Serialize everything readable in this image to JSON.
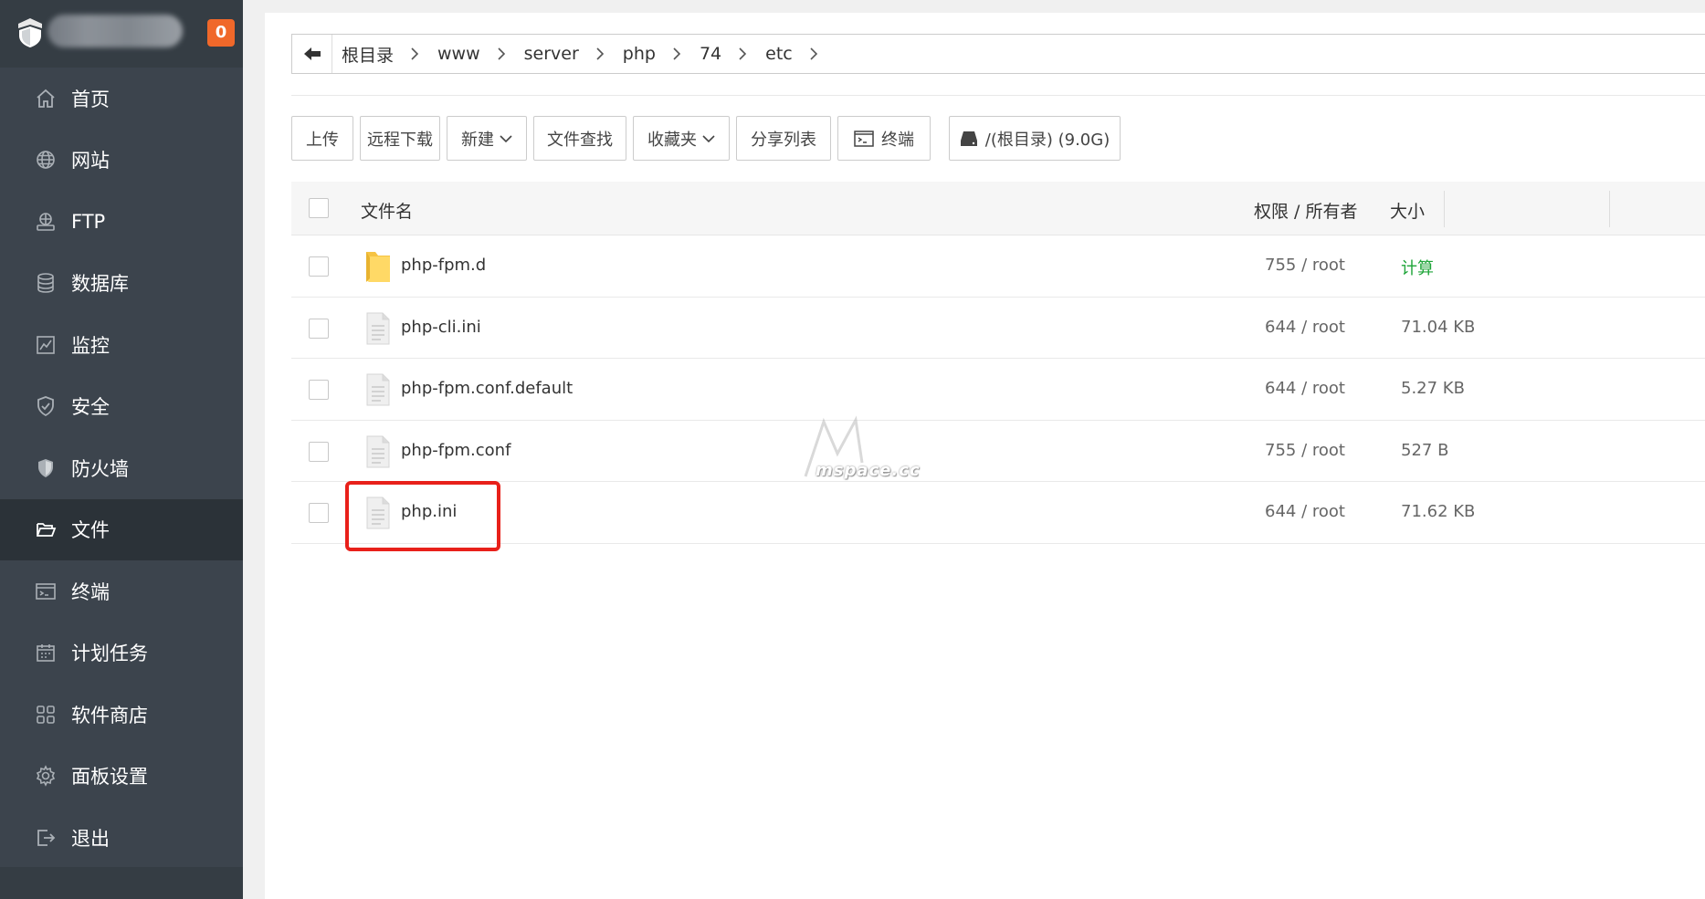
{
  "sidebar": {
    "badge": "0",
    "items": [
      {
        "label": "首页",
        "icon": "home-icon"
      },
      {
        "label": "网站",
        "icon": "globe-icon"
      },
      {
        "label": "FTP",
        "icon": "ftp-icon"
      },
      {
        "label": "数据库",
        "icon": "database-icon"
      },
      {
        "label": "监控",
        "icon": "monitor-icon"
      },
      {
        "label": "安全",
        "icon": "shield-check-icon"
      },
      {
        "label": "防火墙",
        "icon": "firewall-shield-icon"
      },
      {
        "label": "文件",
        "icon": "folder-open-icon",
        "active": true
      },
      {
        "label": "终端",
        "icon": "terminal-icon"
      },
      {
        "label": "计划任务",
        "icon": "calendar-icon"
      },
      {
        "label": "软件商店",
        "icon": "grid-apps-icon"
      },
      {
        "label": "面板设置",
        "icon": "gear-icon"
      },
      {
        "label": "退出",
        "icon": "logout-icon"
      }
    ]
  },
  "breadcrumb": [
    "根目录",
    "www",
    "server",
    "php",
    "74",
    "etc"
  ],
  "toolbar": {
    "upload": "上传",
    "remote_download": "远程下载",
    "new": "新建",
    "file_search": "文件查找",
    "favorites": "收藏夹",
    "share_list": "分享列表",
    "terminal": "终端",
    "disk": "/(根目录) (9.0G)"
  },
  "table": {
    "headers": {
      "name": "文件名",
      "perm": "权限 / 所有者",
      "size": "大小"
    },
    "rows": [
      {
        "name": "php-fpm.d",
        "type": "folder",
        "perm": "755 / root",
        "size": "计算"
      },
      {
        "name": "php-cli.ini",
        "type": "file",
        "perm": "644 / root",
        "size": "71.04 KB"
      },
      {
        "name": "php-fpm.conf.default",
        "type": "file",
        "perm": "644 / root",
        "size": "5.27 KB"
      },
      {
        "name": "php-fpm.conf",
        "type": "file",
        "perm": "755 / root",
        "size": "527 B"
      },
      {
        "name": "php.ini",
        "type": "file",
        "perm": "644 / root",
        "size": "71.62 KB"
      }
    ]
  },
  "watermark": "mspace.cc",
  "colors": {
    "sidebar": "#3c444d",
    "sidebar_active": "#2b3238",
    "badge": "#f0682a",
    "green": "#20a53a",
    "highlight": "#e8201a"
  }
}
